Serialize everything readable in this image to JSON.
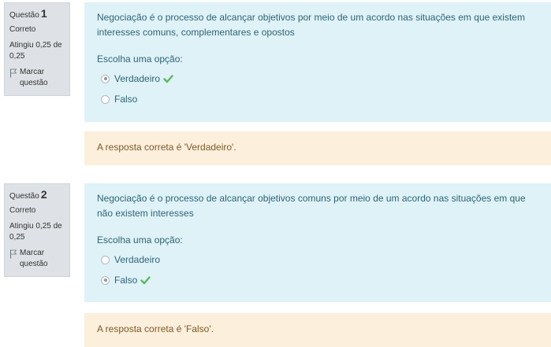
{
  "questions": [
    {
      "label": "Questão",
      "number": "1",
      "state": "Correto",
      "grade": "Atingiu 0,25 de 0,25",
      "flag_label": "Marcar questão",
      "text": "Negociação é o processo de alcançar objetivos por meio de um acordo nas situações em que existem interesses comuns, complementares e opostos",
      "prompt": "Escolha uma opção:",
      "options": [
        {
          "label": "Verdadeiro",
          "selected": true,
          "correct_mark": true
        },
        {
          "label": "Falso",
          "selected": false,
          "correct_mark": false
        }
      ],
      "feedback": "A resposta correta é 'Verdadeiro'."
    },
    {
      "label": "Questão",
      "number": "2",
      "state": "Correto",
      "grade": "Atingiu 0,25 de 0,25",
      "flag_label": "Marcar questão",
      "text": "Negociação é o processo de alcançar objetivos comuns por meio de um acordo nas situações em que não existem interesses",
      "prompt": "Escolha uma opção:",
      "options": [
        {
          "label": "Verdadeiro",
          "selected": false,
          "correct_mark": false
        },
        {
          "label": "Falso",
          "selected": true,
          "correct_mark": true
        }
      ],
      "feedback": "A resposta correta é 'Falso'."
    }
  ],
  "colors": {
    "info_bg": "#dee2e6",
    "formulation_bg": "#def2f8",
    "formulation_text": "#2f6473",
    "outcome_bg": "#fcefdc",
    "outcome_text": "#7d5a29",
    "check": "#5cb85c"
  },
  "icons": {
    "flag": "flag-icon",
    "check": "check-icon"
  }
}
